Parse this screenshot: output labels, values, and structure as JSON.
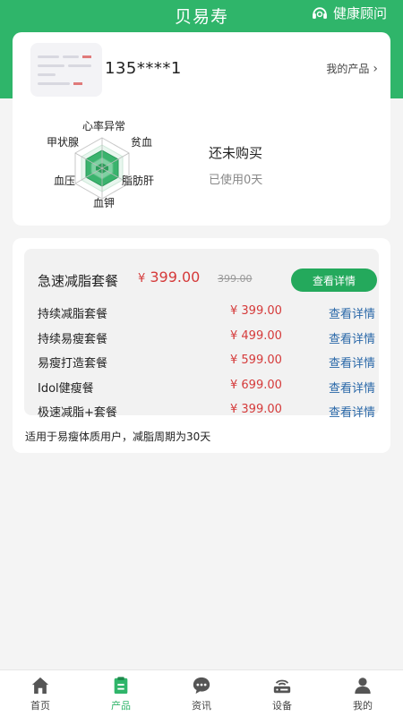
{
  "header": {
    "title": "贝易寿",
    "consult_label": "健康顾问"
  },
  "profile": {
    "phone": "135****1",
    "my_products_label": "我的产品",
    "radar_labels": {
      "top": "心率异常",
      "top_right": "贫血",
      "right": "脂肪肝",
      "bottom": "血钾",
      "left": "血压",
      "top_left": "甲状腺"
    },
    "purchase_status": "还未购买",
    "used_days": "已使用0天"
  },
  "products": {
    "featured": {
      "name": "急速减脂套餐",
      "currency": "¥",
      "price": "399.00",
      "original_price": "399.00",
      "button_label": "查看详情"
    },
    "list": [
      {
        "name": "持续减脂套餐",
        "price": "¥ 399.00",
        "action": "查看详情"
      },
      {
        "name": "持续易瘦套餐",
        "price": "¥ 499.00",
        "action": "查看详情"
      },
      {
        "name": "易瘦打造套餐",
        "price": "¥ 599.00",
        "action": "查看详情"
      },
      {
        "name": "Idol健瘦餐",
        "price": "¥ 699.00",
        "action": "查看详情"
      },
      {
        "name": "极速减脂+套餐",
        "price": "¥ 399.00",
        "action": "查看详情"
      }
    ],
    "note": "适用于易瘦体质用户，减脂周期为30天"
  },
  "tabbar": {
    "items": [
      {
        "label": "首页",
        "icon": "home-icon"
      },
      {
        "label": "产品",
        "icon": "clipboard-icon"
      },
      {
        "label": "资讯",
        "icon": "chat-bubble-icon"
      },
      {
        "label": "设备",
        "icon": "router-icon"
      },
      {
        "label": "我的",
        "icon": "user-icon"
      }
    ],
    "active_index": 1
  },
  "colors": {
    "brand_green": "#2fb56a",
    "button_green": "#24a95c",
    "price_red": "#d53a3a",
    "link_blue": "#2a68a8"
  }
}
